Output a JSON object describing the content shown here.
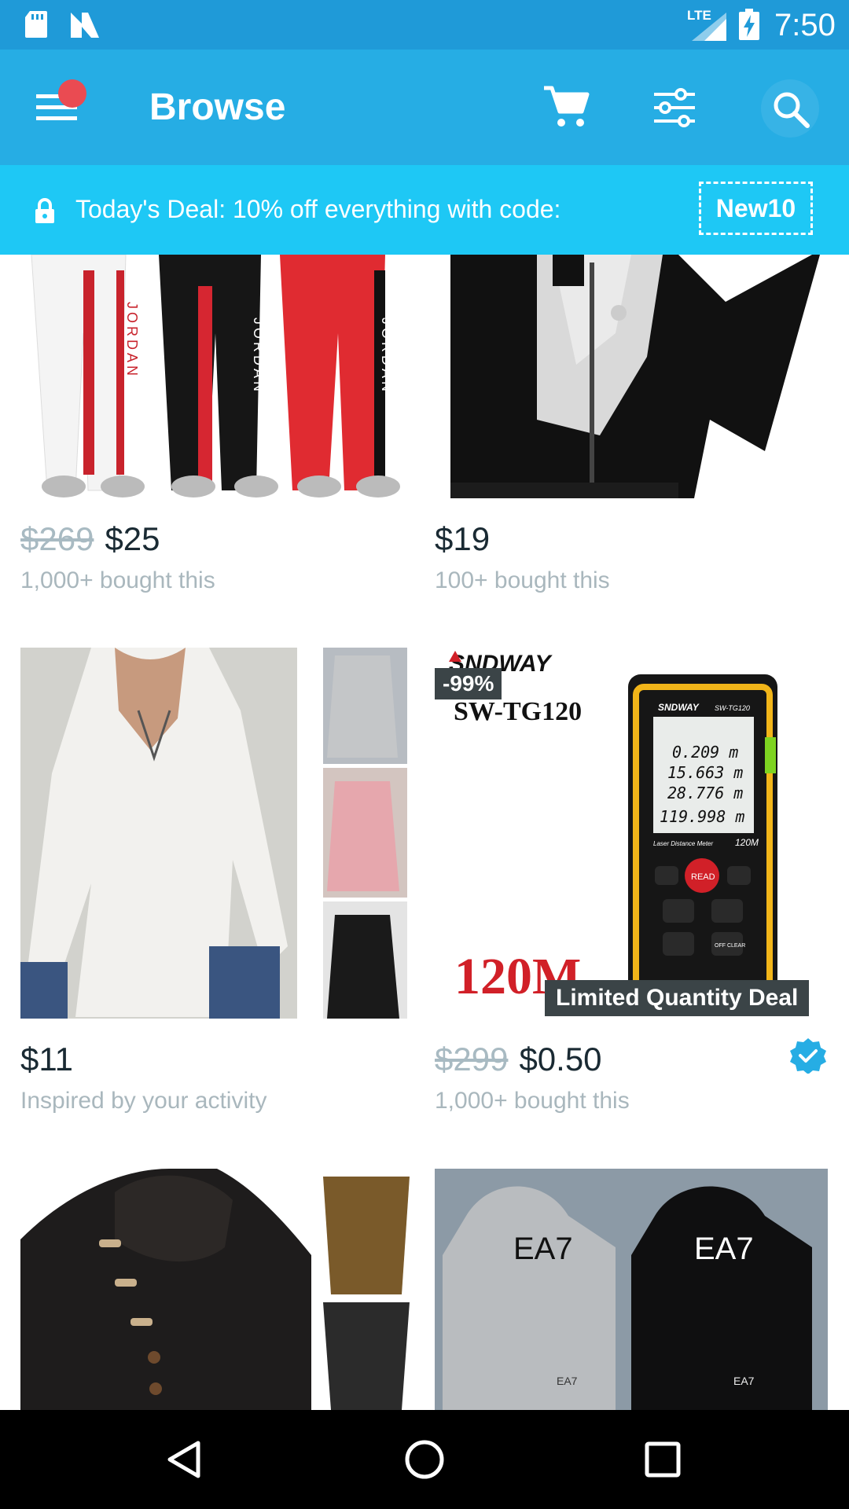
{
  "status_bar": {
    "network": "LTE",
    "time": "7:50"
  },
  "app_bar": {
    "title": "Browse",
    "icons": [
      "menu-icon",
      "cart-icon",
      "filter-icon",
      "search-icon"
    ],
    "notification_dot": true
  },
  "deal_banner": {
    "text": "Today's Deal: 10% off everything with code:",
    "code": "New10"
  },
  "products": [
    {
      "old_price": "$269",
      "price": "$25",
      "subtitle": "1,000+ bought this"
    },
    {
      "price": "$19",
      "subtitle": "100+ bought this"
    },
    {
      "price": "$11",
      "subtitle": "Inspired by your activity"
    },
    {
      "old_price": "$299",
      "price": "$0.50",
      "subtitle": "1,000+ bought this",
      "discount_badge": "-99%",
      "deal_badge": "Limited Quantity Deal",
      "verified": true,
      "image_text": {
        "brand": "SNDWAY",
        "model": "SW-TG120",
        "range": "120M",
        "device_brand": "SNDWAY",
        "device_model": "SW-TG120",
        "readings": [
          "0.209 m",
          "15.663 m",
          "28.776 m",
          "119.998 m"
        ],
        "device_label": "Laser Distance Meter",
        "device_range": "120M",
        "read_button": "READ",
        "off_button": "OFF CLEAR"
      }
    },
    {
      "image_text": {}
    },
    {
      "image_text": {
        "logo": "EA7"
      }
    }
  ],
  "product_image_text": {
    "jordan": "JORDAN"
  },
  "colors": {
    "status_bar": "#1f9ad8",
    "app_bar": "#26ade4",
    "banner": "#1ec8f5",
    "dot": "#ea4b52",
    "badge": "#3b4447",
    "verified": "#26ade4"
  }
}
